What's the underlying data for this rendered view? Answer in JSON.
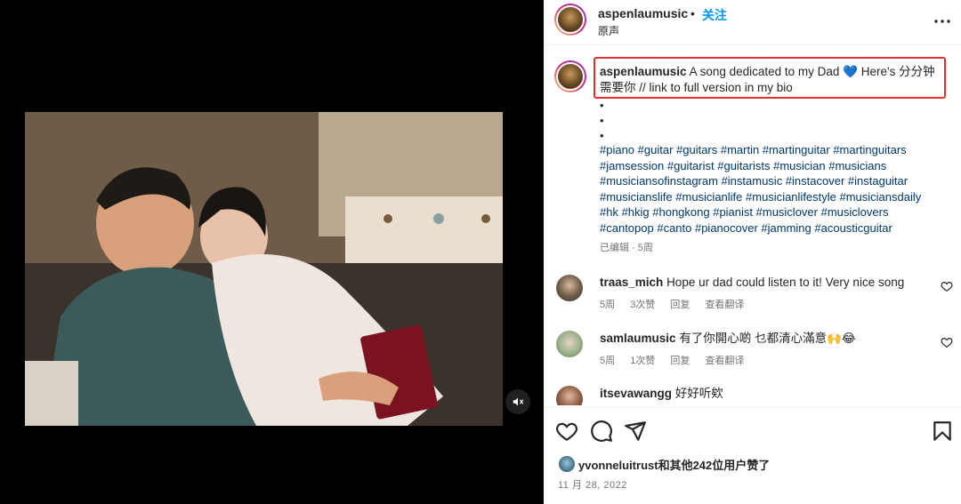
{
  "post": {
    "username": "aspenlaumusic",
    "separator": "•",
    "follow_label": "关注",
    "audio_label": "原声"
  },
  "caption": {
    "username": "aspenlaumusic",
    "text": "A song dedicated to my Dad 💙 Here's 分分钟 需要你 // link to full version in my bio",
    "bullets": [
      "•",
      "•",
      "•"
    ],
    "hashtag_lines": [
      "#piano #guitar #guitars #martin #martinguitar #martinguitars",
      "#jamsession #guitarist #guitarists #musician #musicians",
      "#musiciansofinstagram #instamusic #instacover #instaguitar",
      "#musicianslife #musicianlife #musicianlifestyle #musiciansdaily",
      "#hk #hkig #hongkong #pianist #musiclover #musiclovers",
      "#cantopop #canto #pianocover #jamming #acousticguitar"
    ],
    "meta": "已编辑 · 5周"
  },
  "comments": [
    {
      "username": "traas_mich",
      "text": "Hope ur dad could listen to it! Very nice song",
      "age": "5周",
      "likes": "3次赞",
      "reply": "回复",
      "translate": "查看翻译"
    },
    {
      "username": "samlaumusic",
      "text": "有了你開心啲 乜都清心滿意🙌😂",
      "age": "5周",
      "likes": "1次赞",
      "reply": "回复",
      "translate": "查看翻译"
    },
    {
      "username": "itsevawangg",
      "text": "好好听欸"
    }
  ],
  "likes_text": "yvonneluitrust和其他242位用户赞了",
  "date": "11 月 28, 2022",
  "colors": {
    "accent": "#0095f6",
    "highlight_box": "#e0302f",
    "hashtag": "#00376b",
    "muted": "#737373"
  },
  "icons": [
    "mute-icon",
    "more-icon",
    "heart-icon",
    "comment-icon",
    "share-icon",
    "save-icon"
  ]
}
